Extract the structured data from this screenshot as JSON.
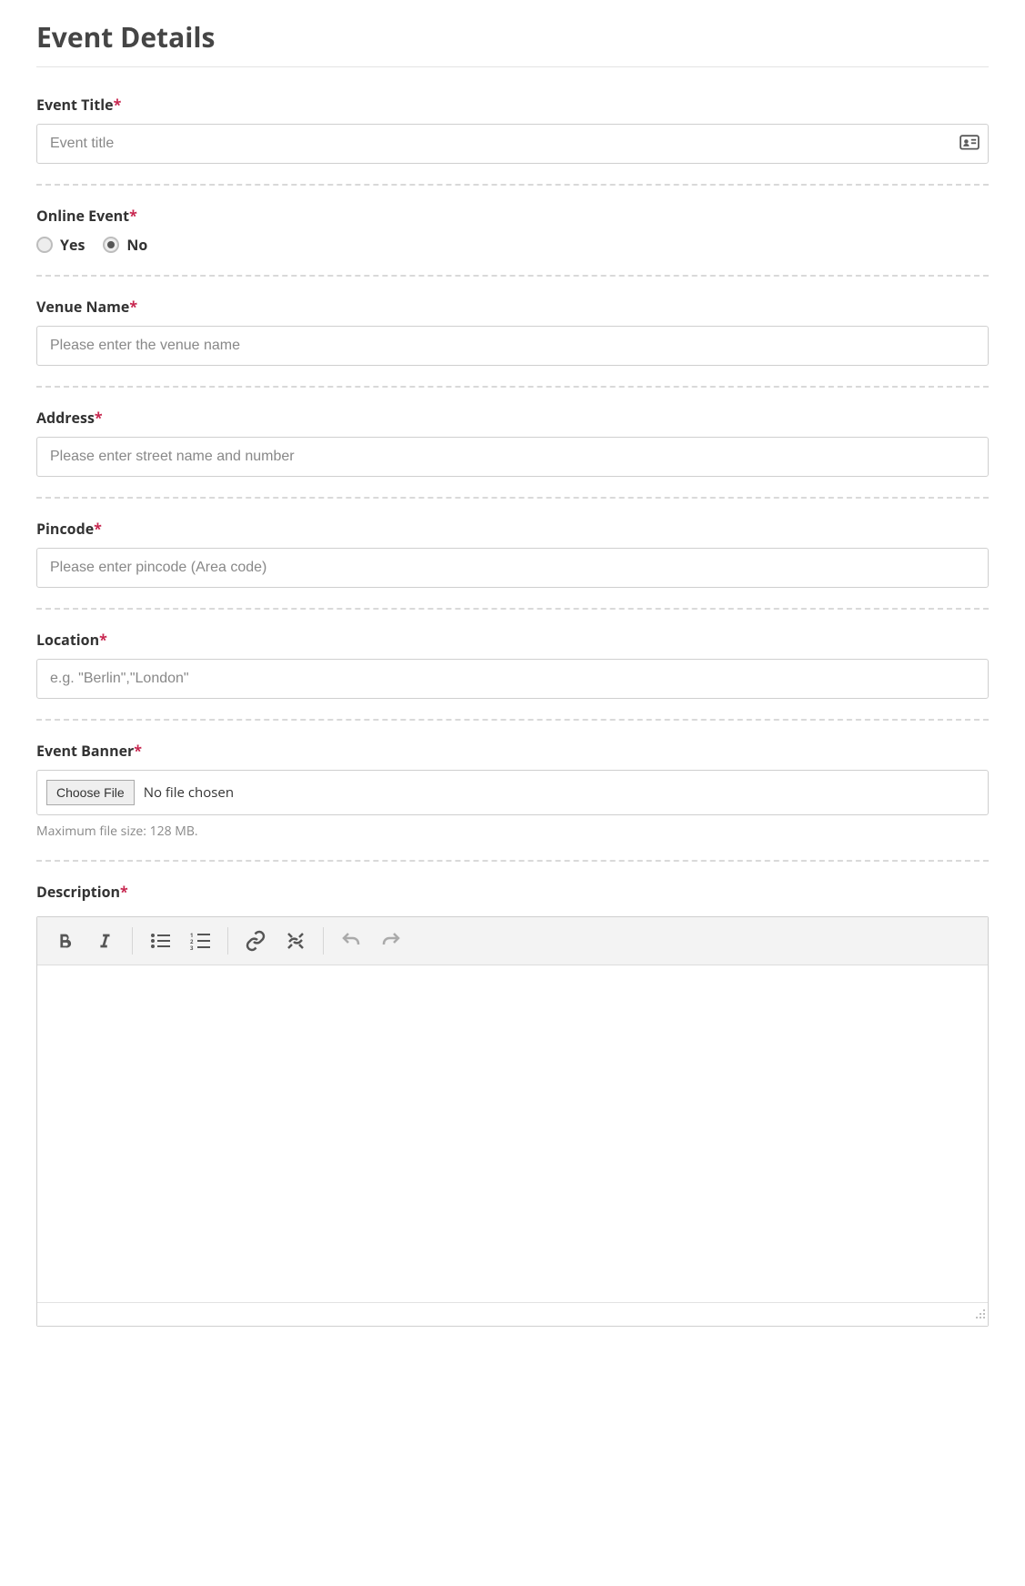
{
  "page_title": "Event Details",
  "fields": {
    "event_title": {
      "label": "Event Title",
      "placeholder": "Event title",
      "required_marker": "*"
    },
    "online_event": {
      "label": "Online Event",
      "required_marker": "*",
      "option_yes": "Yes",
      "option_no": "No",
      "selected": "No"
    },
    "venue_name": {
      "label": "Venue Name",
      "placeholder": "Please enter the venue name",
      "required_marker": "*"
    },
    "address": {
      "label": "Address",
      "placeholder": "Please enter street name and number",
      "required_marker": "*"
    },
    "pincode": {
      "label": "Pincode",
      "placeholder": "Please enter pincode (Area code)",
      "required_marker": "*"
    },
    "location": {
      "label": "Location",
      "placeholder": "e.g. \"Berlin\",\"London\"",
      "required_marker": "*"
    },
    "event_banner": {
      "label": "Event Banner",
      "required_marker": "*",
      "choose_button": "Choose File",
      "file_status": "No file chosen",
      "hint": "Maximum file size: 128 MB."
    },
    "description": {
      "label": "Description",
      "required_marker": "*"
    }
  }
}
